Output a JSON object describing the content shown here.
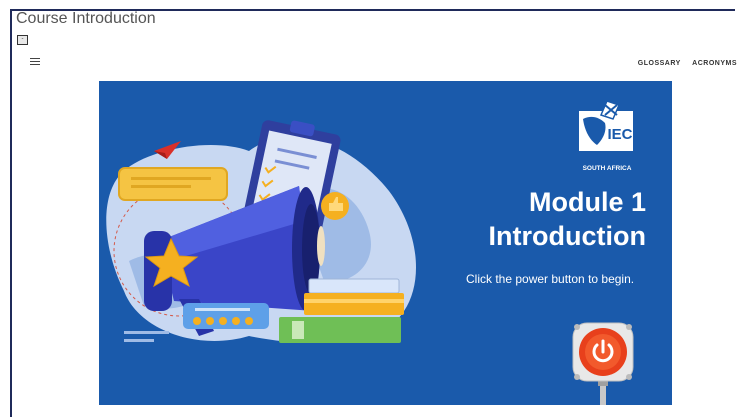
{
  "window": {
    "title": "Course Introduction"
  },
  "toolbar": {
    "toggle_label": "-"
  },
  "nav": {
    "glossary": "GLOSSARY",
    "acronyms": "ACRONYMS"
  },
  "slide": {
    "logo_caption": "SOUTH AFRICA",
    "logo_letters": "IEC",
    "heading_line1": "Module 1",
    "heading_line2": "Introduction",
    "instruction": "Click the power button to begin."
  },
  "colors": {
    "slide_bg": "#1a5aab",
    "frame_border": "#1f2a5a",
    "power_red": "#e8401c"
  },
  "icons": [
    "menu-icon",
    "power-icon",
    "megaphone-icon",
    "star-icon",
    "thumbs-up-icon",
    "paper-plane-icon"
  ]
}
